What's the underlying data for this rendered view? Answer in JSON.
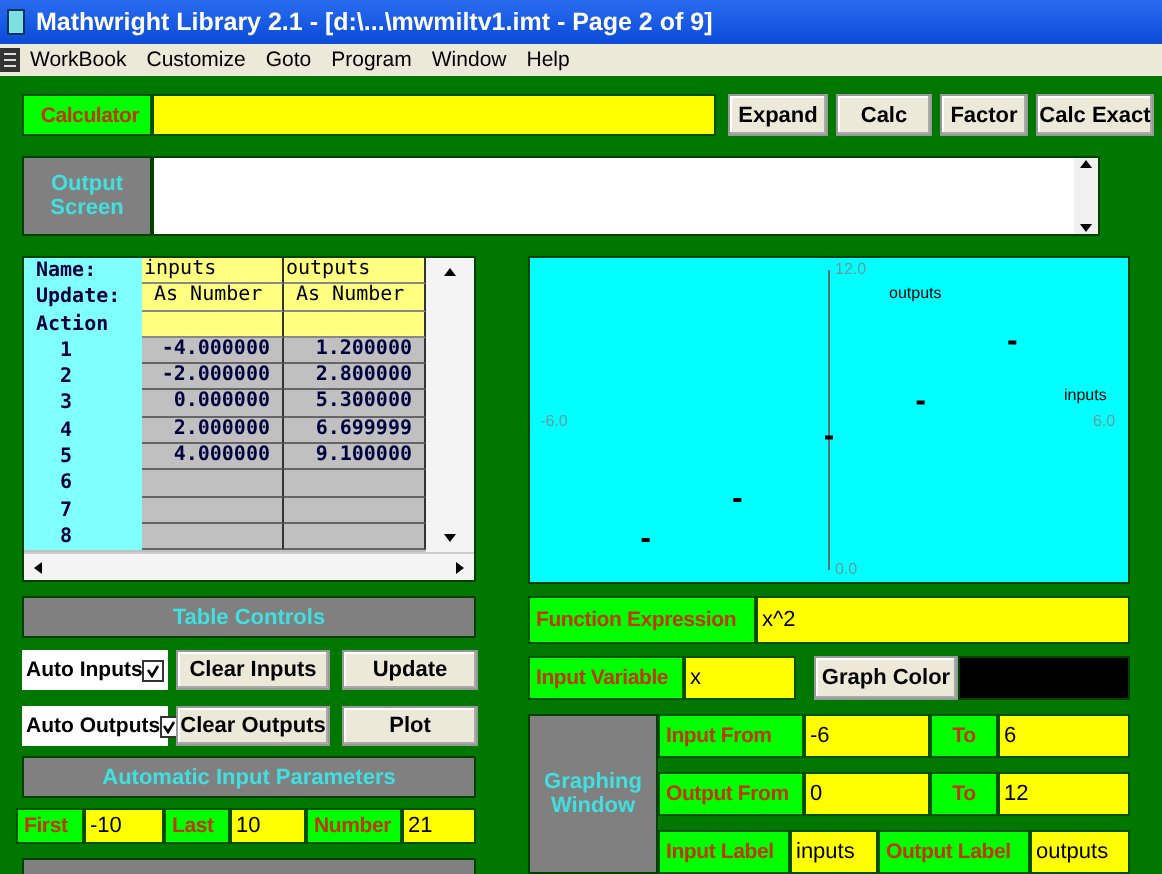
{
  "window": {
    "title": "Mathwright Library 2.1 - [d:\\...\\mwmiltv1.imt - Page 2 of 9]"
  },
  "menu": [
    "WorkBook",
    "Customize",
    "Goto",
    "Program",
    "Window",
    "Help"
  ],
  "calculator": {
    "label": "Calculator",
    "buttons": [
      "Expand",
      "Calc",
      "Factor",
      "Calc Exact"
    ]
  },
  "output_screen": {
    "label": "Output Screen"
  },
  "table": {
    "row_labels": [
      "Name:",
      "Update:",
      "Action"
    ],
    "columns": [
      {
        "name": "inputs",
        "update": "As Number"
      },
      {
        "name": "outputs",
        "update": "As Number"
      }
    ],
    "rows": [
      {
        "index": "1",
        "values": [
          "-4.000000",
          "1.200000"
        ]
      },
      {
        "index": "2",
        "values": [
          "-2.000000",
          "2.800000"
        ]
      },
      {
        "index": "3",
        "values": [
          "0.000000",
          "5.300000"
        ]
      },
      {
        "index": "4",
        "values": [
          "2.000000",
          "6.699999"
        ]
      },
      {
        "index": "5",
        "values": [
          "4.000000",
          "9.100000"
        ]
      },
      {
        "index": "6"
      },
      {
        "index": "7"
      },
      {
        "index": "8"
      }
    ]
  },
  "graph": {
    "chart_data": {
      "type": "scatter",
      "xlabel": "inputs",
      "ylabel": "outputs",
      "xlim": [
        -6,
        6
      ],
      "ylim": [
        0,
        12
      ],
      "xticks": [
        {
          "value": -6,
          "label": "-6.0"
        },
        {
          "value": 6,
          "label": "6.0"
        }
      ],
      "yticks": [
        {
          "value": 0,
          "label": "0.0"
        },
        {
          "value": 12,
          "label": "12.0"
        }
      ],
      "x": [
        -4,
        -2,
        0,
        2,
        4
      ],
      "series": [
        {
          "color": "#000000",
          "values": [
            1.2,
            2.8,
            5.3,
            6.7,
            9.1
          ]
        }
      ]
    }
  },
  "table_controls": {
    "title": "Table Controls",
    "rows": [
      {
        "checkbox": {
          "label": "Auto Inputs",
          "checked": true
        },
        "buttons": [
          "Clear Inputs",
          "Update"
        ]
      },
      {
        "checkbox": {
          "label": "Auto Outputs",
          "checked": true
        },
        "buttons": [
          "Clear Outputs",
          "Plot"
        ]
      }
    ]
  },
  "auto_input_parameters": {
    "title": "Automatic Input Parameters",
    "fields": [
      {
        "label": "First",
        "value": "-10"
      },
      {
        "label": "Last",
        "value": "10"
      },
      {
        "label": "Number",
        "value": "21"
      }
    ]
  },
  "function_expression": {
    "label": "Function Expression",
    "value": "x^2"
  },
  "input_variable": {
    "label": "Input Variable",
    "value": "x"
  },
  "graph_color": {
    "button": "Graph Color",
    "color": "#000000"
  },
  "graphing_window": {
    "title": "Graphing Window",
    "rows": [
      {
        "label": "Input From",
        "value": "-6",
        "to_label": "To",
        "to_value": "6"
      },
      {
        "label": "Output From",
        "value": "0",
        "to_label": "To",
        "to_value": "12"
      }
    ],
    "input_label": {
      "label": "Input Label",
      "value": "inputs"
    },
    "output_label": {
      "label": "Output Label",
      "value": "outputs"
    }
  }
}
